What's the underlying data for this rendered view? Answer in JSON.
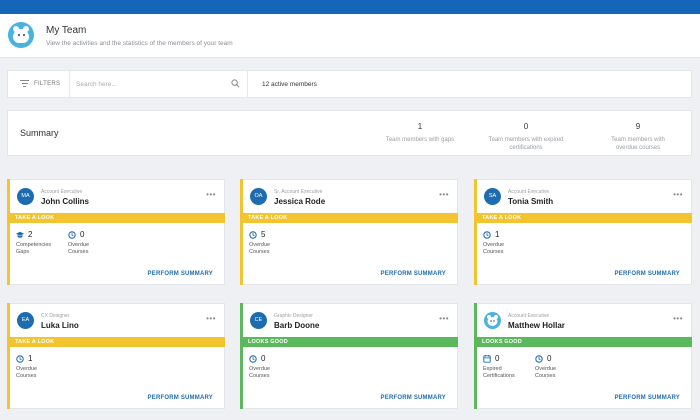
{
  "header": {
    "title": "My Team",
    "subtitle": "View the activities and the statistics of the members of your team"
  },
  "filters": {
    "label": "FILTERS",
    "search_placeholder": "Search here...",
    "active_members": "12 active members"
  },
  "summary": {
    "title": "Summary",
    "stats": [
      {
        "value": "1",
        "label_line1": "Team members with gaps",
        "label_line2": ""
      },
      {
        "value": "0",
        "label_line1": "Team members with expired",
        "label_line2": "certifications"
      },
      {
        "value": "9",
        "label_line1": "Team members with",
        "label_line2": "overdue courses"
      }
    ]
  },
  "colors": {
    "accent": "#1565b8",
    "warn": "#f2c42f",
    "good": "#5cb85c",
    "link": "#1e6cb0"
  },
  "cards": [
    {
      "initials": "MA",
      "role": "Account Executive",
      "name": "John Collins",
      "status": "TAKE A LOOK",
      "status_type": "warn",
      "more": "•••",
      "metrics": [
        {
          "icon": "graduation-cap-icon",
          "value": "2",
          "label_line1": "Competencies",
          "label_line2": "Gaps"
        },
        {
          "icon": "clock-icon",
          "value": "0",
          "label_line1": "Overdue",
          "label_line2": "Courses"
        }
      ],
      "action": "PERFORM SUMMARY"
    },
    {
      "initials": "OA",
      "role": "Sr. Account Executive",
      "name": "Jessica Rode",
      "status": "TAKE A LOOK",
      "status_type": "warn",
      "more": "•••",
      "metrics": [
        {
          "icon": "clock-icon",
          "value": "5",
          "label_line1": "Overdue",
          "label_line2": "Courses"
        }
      ],
      "action": "PERFORM SUMMARY"
    },
    {
      "initials": "SA",
      "role": "Account Executive",
      "name": "Tonia Smith",
      "status": "TAKE A LOOK",
      "status_type": "warn",
      "more": "•••",
      "metrics": [
        {
          "icon": "clock-icon",
          "value": "1",
          "label_line1": "Overdue",
          "label_line2": "Courses"
        }
      ],
      "action": "PERFORM SUMMARY"
    },
    {
      "initials": "EA",
      "role": "CX Designer",
      "name": "Luka Lino",
      "status": "TAKE A LOOK",
      "status_type": "warn",
      "more": "•••",
      "metrics": [
        {
          "icon": "clock-icon",
          "value": "1",
          "label_line1": "Overdue",
          "label_line2": "Courses"
        }
      ],
      "action": "PERFORM SUMMARY"
    },
    {
      "initials": "CE",
      "role": "Graphic Designer",
      "name": "Barb Doone",
      "status": "LOOKS GOOD",
      "status_type": "good",
      "more": "•••",
      "metrics": [
        {
          "icon": "clock-icon",
          "value": "0",
          "label_line1": "Overdue",
          "label_line2": "Courses"
        }
      ],
      "action": "PERFORM SUMMARY"
    },
    {
      "initials": "",
      "avatar_icon": "polar-bear-avatar-icon",
      "role": "Account Executive",
      "name": "Matthew Hollar",
      "status": "LOOKS GOOD",
      "status_type": "good",
      "more": "•••",
      "metrics": [
        {
          "icon": "certificate-icon",
          "value": "0",
          "label_line1": "Expired",
          "label_line2": "Certifications"
        },
        {
          "icon": "clock-icon",
          "value": "0",
          "label_line1": "Overdue",
          "label_line2": "Courses"
        }
      ],
      "action": "PERFORM SUMMARY"
    }
  ]
}
